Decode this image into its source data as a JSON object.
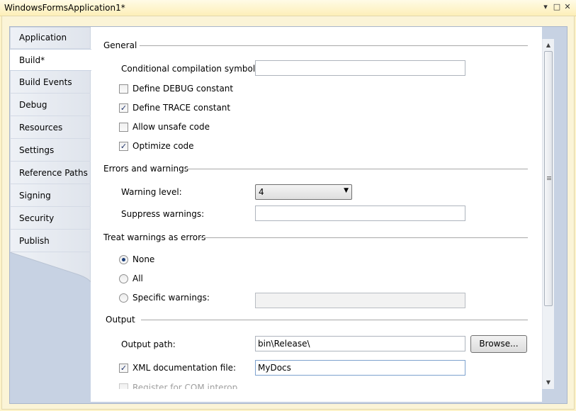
{
  "window": {
    "title": "WindowsFormsApplication1*",
    "controls": [
      "▾",
      "□",
      "✕"
    ]
  },
  "tabs": [
    {
      "label": "Application",
      "active": false
    },
    {
      "label": "Build*",
      "active": true
    },
    {
      "label": "Build Events",
      "active": false
    },
    {
      "label": "Debug",
      "active": false
    },
    {
      "label": "Resources",
      "active": false
    },
    {
      "label": "Settings",
      "active": false
    },
    {
      "label": "Reference Paths",
      "active": false
    },
    {
      "label": "Signing",
      "active": false
    },
    {
      "label": "Security",
      "active": false
    },
    {
      "label": "Publish",
      "active": false
    }
  ],
  "general": {
    "heading": "General",
    "conditional_symbols_label": "Conditional compilation symbols:",
    "conditional_symbols_value": "",
    "define_debug": {
      "label": "Define DEBUG constant",
      "checked": false
    },
    "define_trace": {
      "label": "Define TRACE constant",
      "checked": true
    },
    "allow_unsafe": {
      "label": "Allow unsafe code",
      "checked": false
    },
    "optimize": {
      "label": "Optimize code",
      "checked": true
    }
  },
  "errors": {
    "heading": "Errors and warnings",
    "warning_level_label": "Warning level:",
    "warning_level_value": "4",
    "suppress_label": "Suppress warnings:",
    "suppress_value": ""
  },
  "treat_warnings": {
    "heading": "Treat warnings as errors",
    "none_label": "None",
    "all_label": "All",
    "specific_label": "Specific warnings:",
    "specific_value": "",
    "selected": "None"
  },
  "output": {
    "heading": "Output",
    "path_label": "Output path:",
    "path_value": "bin\\Release\\",
    "browse_label": "Browse...",
    "xml_doc": {
      "label": "XML documentation file:",
      "checked": true
    },
    "xml_doc_value": "MyDocs",
    "com_interop": {
      "label": "Register for COM interop",
      "checked": false
    }
  },
  "colors": {
    "accent_frame": "#fdf3c9",
    "tab_strip": "#dfe5ee",
    "checkmark": "#21356b"
  }
}
